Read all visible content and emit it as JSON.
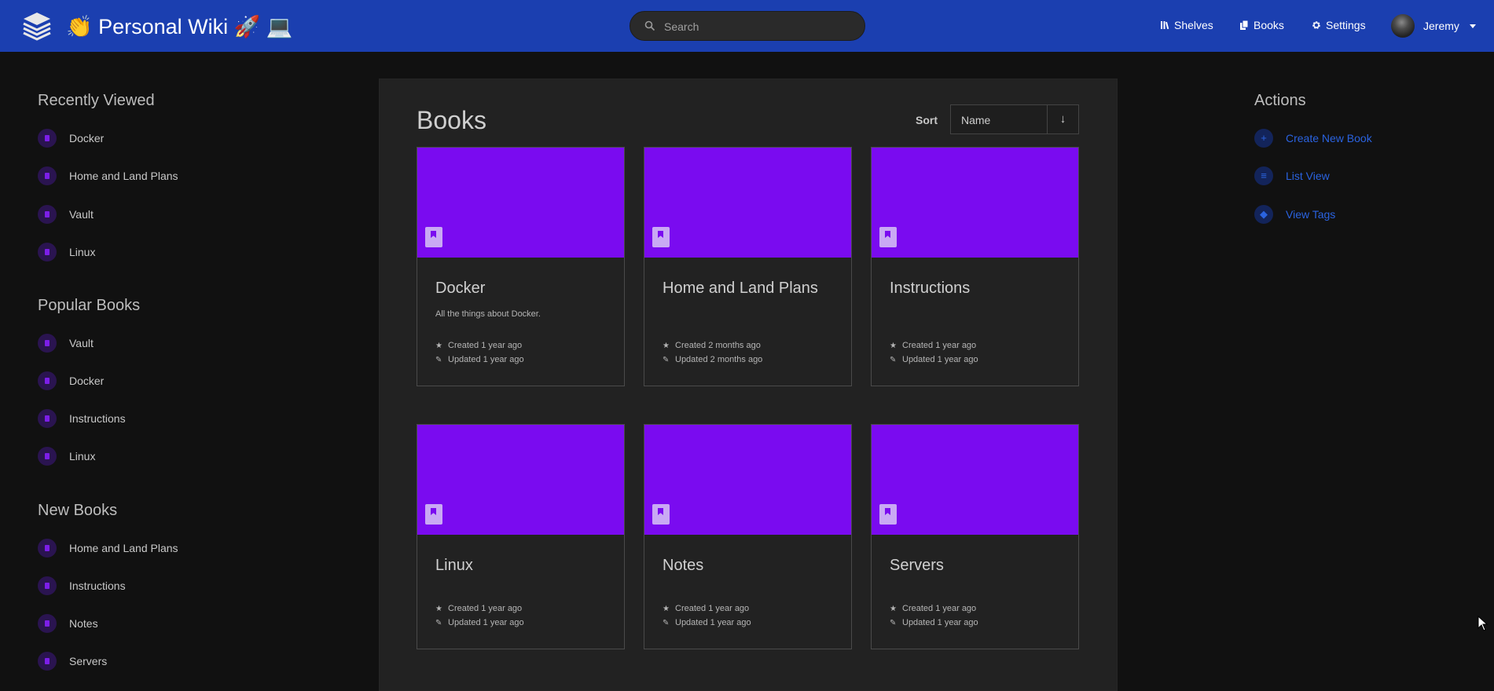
{
  "header": {
    "app_title": "👏 Personal Wiki 🚀 💻",
    "search_placeholder": "Search",
    "nav": {
      "shelves": "Shelves",
      "books": "Books",
      "settings": "Settings"
    },
    "user_name": "Jeremy",
    "icons": {
      "logo": "stacked-books-logo",
      "search": "search-icon",
      "shelves": "shelves-icon",
      "books": "books-icon",
      "settings": "gear-icon"
    }
  },
  "sidebar": {
    "recently_viewed": {
      "title": "Recently Viewed",
      "items": [
        "Docker",
        "Home and Land Plans",
        "Vault",
        "Linux"
      ]
    },
    "popular_books": {
      "title": "Popular Books",
      "items": [
        "Vault",
        "Docker",
        "Instructions",
        "Linux"
      ]
    },
    "new_books": {
      "title": "New Books",
      "items": [
        "Home and Land Plans",
        "Instructions",
        "Notes",
        "Servers"
      ]
    }
  },
  "main": {
    "title": "Books",
    "sort_label": "Sort",
    "sort_value": "Name",
    "sort_direction": "↓",
    "books": [
      {
        "name": "Docker",
        "description": "All the things about Docker.",
        "created": "Created 1 year ago",
        "updated": "Updated 1 year ago"
      },
      {
        "name": "Home and Land Plans",
        "description": "",
        "created": "Created 2 months ago",
        "updated": "Updated 2 months ago"
      },
      {
        "name": "Instructions",
        "description": "",
        "created": "Created 1 year ago",
        "updated": "Updated 1 year ago"
      },
      {
        "name": "Linux",
        "description": "",
        "created": "Created 1 year ago",
        "updated": "Updated 1 year ago"
      },
      {
        "name": "Notes",
        "description": "",
        "created": "Created 1 year ago",
        "updated": "Updated 1 year ago"
      },
      {
        "name": "Servers",
        "description": "",
        "created": "Created 1 year ago",
        "updated": "Updated 1 year ago"
      }
    ]
  },
  "actions": {
    "title": "Actions",
    "items": [
      {
        "label": "Create New Book",
        "icon": "+"
      },
      {
        "label": "List View",
        "icon": "≡"
      },
      {
        "label": "View Tags",
        "icon": "◆"
      }
    ]
  },
  "colors": {
    "header": "#1b3fb0",
    "cover": "#7a0bf0",
    "link": "#2a63e0",
    "background": "#111111",
    "panel": "#222222"
  }
}
